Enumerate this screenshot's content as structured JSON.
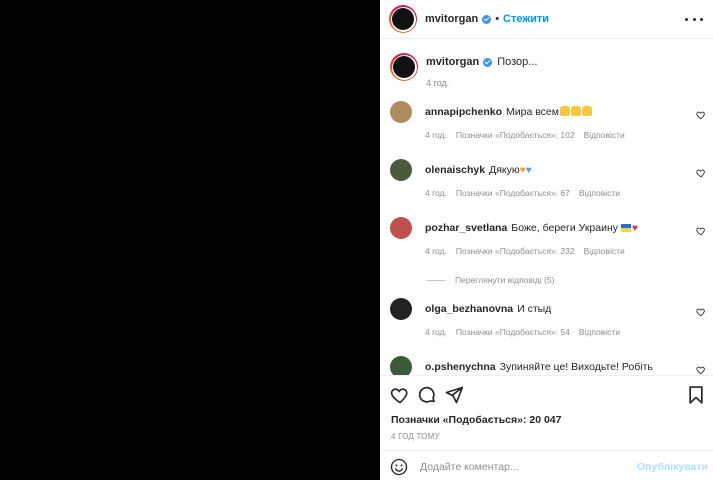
{
  "post": {
    "username": "mvitorgan",
    "follow_label": "Стежити",
    "separator": "•",
    "caption_text": "Позор...",
    "caption_time": "4 год."
  },
  "comments": [
    {
      "username": "annapipchenko",
      "text": "Мира всем",
      "emoji": "pray-x3",
      "time": "4 год.",
      "likes_label": "Позначки «Подобається»: 102",
      "reply_label": "Відповісти",
      "avatar_color": "#b08a5a"
    },
    {
      "username": "olenaischyk",
      "text": "Дякую",
      "emoji": "orange-heart, blue-heart",
      "heart1": "♥",
      "heart2": "♥",
      "time": "4 год.",
      "likes_label": "Позначки «Подобається»: 67",
      "reply_label": "Відповісти",
      "avatar_color": "#4a5a3a"
    },
    {
      "username": "pozhar_svetlana",
      "text": "Боже, береги Украину",
      "emoji": "ukraine-flag, red-heart",
      "heart": "♥",
      "time": "4 год.",
      "likes_label": "Позначки «Подобається»: 232",
      "reply_label": "Відповісти",
      "avatar_color": "#c0504d"
    },
    {
      "username": "olga_bezhanovna",
      "text": "И стыд",
      "time": "4 год.",
      "likes_label": "Позначки «Подобається»: 54",
      "reply_label": "Відповісти",
      "avatar_color": "#222222"
    },
    {
      "username": "o.pshenychna",
      "text": "Зупиняйте це! Виходьте! Робіть щось!!!!!",
      "avatar_color": "#3a5a3a"
    }
  ],
  "view_replies": "Переглянути відповіді (5)",
  "footer": {
    "likes": "Позначки «Подобається»: 20 047",
    "posted_time": "4 ГОД ТОМУ",
    "add_comment_placeholder": "Додайте коментар...",
    "publish_label": "Опублікувати"
  },
  "colors": {
    "accent": "#0095f6",
    "publish_disabled": "#b2dffc",
    "muted": "#8e8e8e",
    "media_bg": "#000000"
  },
  "icons": [
    "more-options-icon",
    "verified-icon",
    "heart-icon",
    "comment-icon",
    "share-icon",
    "bookmark-icon",
    "emoji-icon"
  ]
}
